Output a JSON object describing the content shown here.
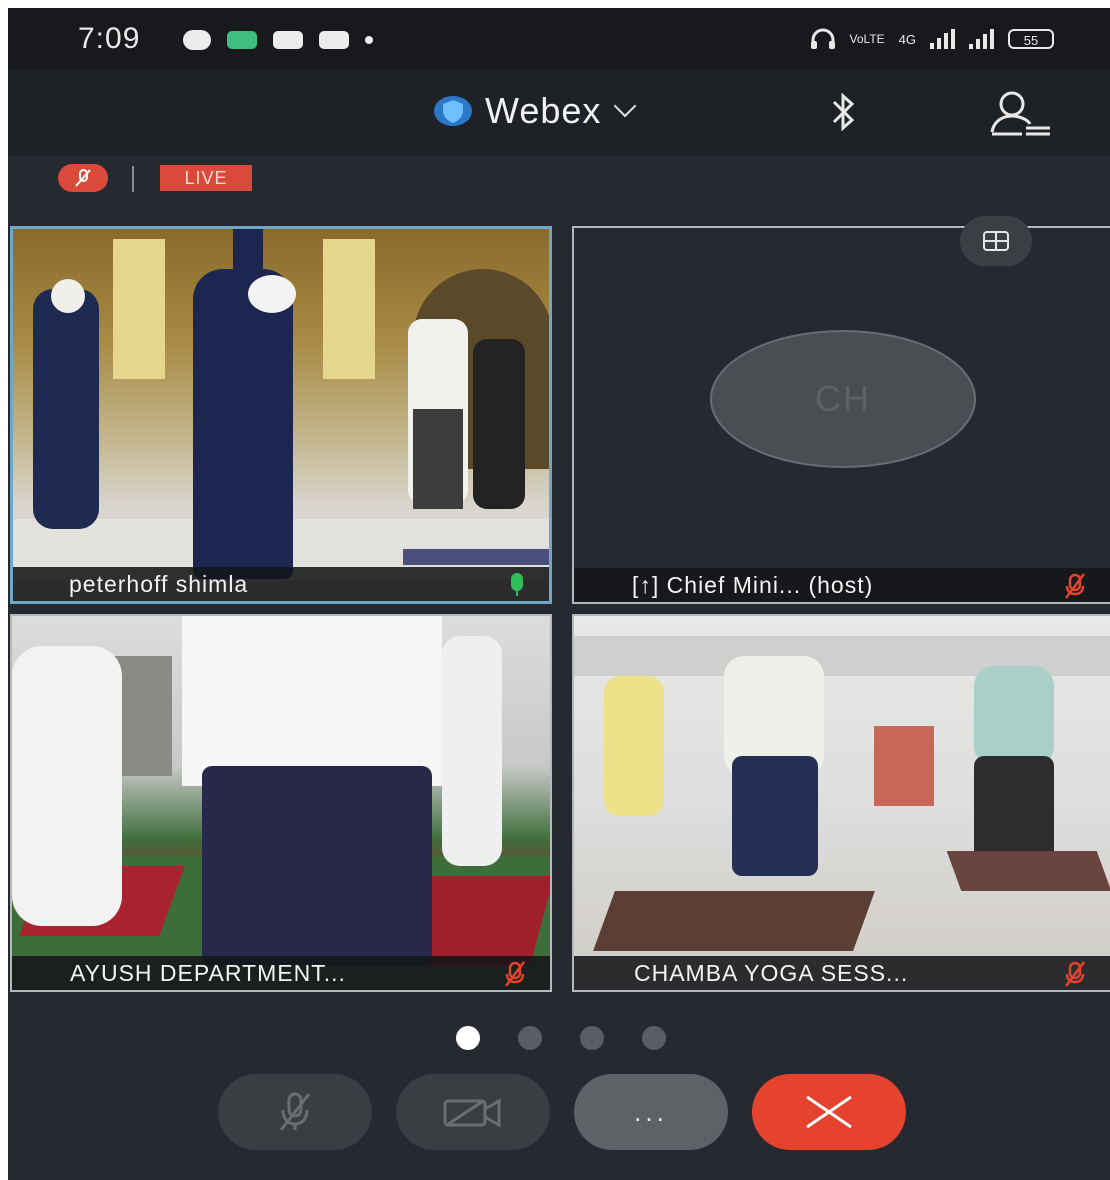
{
  "status_bar": {
    "time": "7:09",
    "network_label": "4G",
    "battery": "55"
  },
  "header": {
    "app_title": "Webex",
    "brand_color": "#3aa0e8",
    "icons": [
      "shield-icon",
      "chevron-down-icon",
      "bluetooth-icon",
      "participants-icon"
    ]
  },
  "meeting_bar": {
    "live_label": "LIVE",
    "accent_color": "#d94a3a"
  },
  "tiles": [
    {
      "name": "peterhoff shimla",
      "mic": "active",
      "active_speaker": true
    },
    {
      "name": "[↑] Chief Mini... (host)",
      "avatar_initials": "CH",
      "mic": "muted"
    },
    {
      "name": "AYUSH DEPARTMENT...",
      "mic": "muted"
    },
    {
      "name": "CHAMBA YOGA SESS...",
      "mic": "muted"
    }
  ],
  "pager": {
    "pages": 4,
    "current": 1
  },
  "controls": {
    "more_label": "...",
    "end_color": "#e5432d"
  }
}
